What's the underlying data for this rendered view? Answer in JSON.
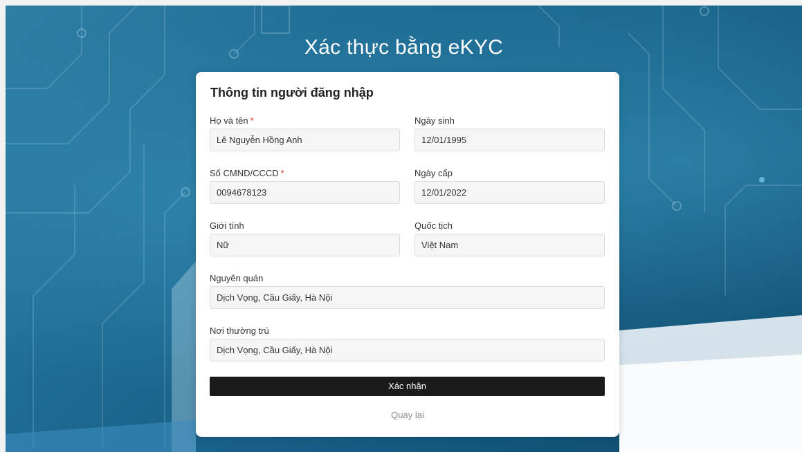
{
  "page": {
    "title": "Xác thực bằng eKYC"
  },
  "card": {
    "title": "Thông tin người đăng nhập",
    "required_mark": "*",
    "fields": {
      "full_name": {
        "label": "Họ và tên",
        "value": "Lê Nguyễn Hồng Anh",
        "required": true
      },
      "dob": {
        "label": "Ngày sinh",
        "value": "12/01/1995"
      },
      "id_number": {
        "label": "Số CMND/CCCD",
        "value": "0094678123",
        "required": true
      },
      "issue_date": {
        "label": "Ngày cấp",
        "value": "12/01/2022"
      },
      "gender": {
        "label": "Giới tính",
        "value": "Nữ"
      },
      "nationality": {
        "label": "Quốc tịch",
        "value": "Việt Nam"
      },
      "hometown": {
        "label": "Nguyên quán",
        "value": "Dịch Vọng, Cầu Giấy, Hà Nội"
      },
      "residence": {
        "label": "Nơi thường trú",
        "value": "Dịch Vọng, Cầu Giấy, Hà Nội"
      }
    },
    "submit_label": "Xác nhận",
    "back_label": "Quay lại"
  },
  "colors": {
    "accent": "#1b1b1b",
    "required": "#d9342b",
    "background": "#1d6a92"
  }
}
